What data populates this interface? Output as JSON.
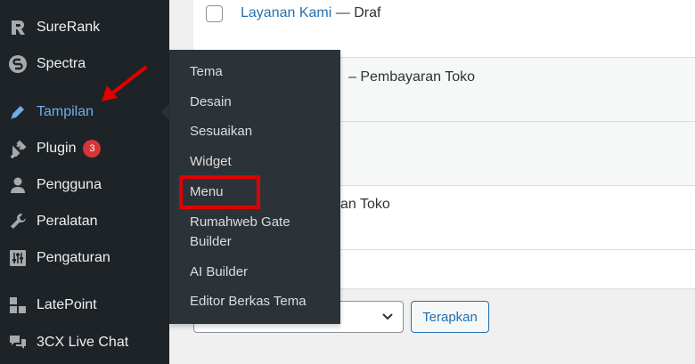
{
  "sidebar": {
    "items": [
      {
        "label": "SureRank",
        "icon": "surerank-icon"
      },
      {
        "label": "Spectra",
        "icon": "spectra-icon"
      },
      {
        "label": "Tampilan",
        "icon": "appearance-brush-icon"
      },
      {
        "label": "Plugin",
        "icon": "plugin-icon",
        "badge": "3"
      },
      {
        "label": "Pengguna",
        "icon": "user-icon"
      },
      {
        "label": "Peralatan",
        "icon": "wrench-icon"
      },
      {
        "label": "Pengaturan",
        "icon": "settings-sliders-icon"
      },
      {
        "label": "LatePoint",
        "icon": "latepoint-icon"
      },
      {
        "label": "3CX Live Chat",
        "icon": "chat-bubbles-icon"
      }
    ],
    "current": "Tampilan"
  },
  "submenu": {
    "items": [
      "Tema",
      "Desain",
      "Sesuaikan",
      "Widget",
      "Menu",
      "Rumahweb Gate Builder",
      "AI Builder",
      "Editor Berkas Tema"
    ],
    "highlighted": "Menu",
    "highlight_color": "#e00000"
  },
  "pages": {
    "rows": [
      {
        "title": "Layanan Kami",
        "state": "— Draf"
      },
      {
        "title": "– Pembayaran Toko"
      },
      {
        "title": ""
      },
      {
        "title": "an Toko"
      },
      {
        "title": ""
      }
    ]
  },
  "bulk": {
    "apply_label": "Terapkan"
  },
  "colors": {
    "sidebar_bg": "#1d2327",
    "submenu_bg": "#2c3338",
    "accent": "#2271b1",
    "badge": "#d63638",
    "annotation": "#e00000"
  }
}
